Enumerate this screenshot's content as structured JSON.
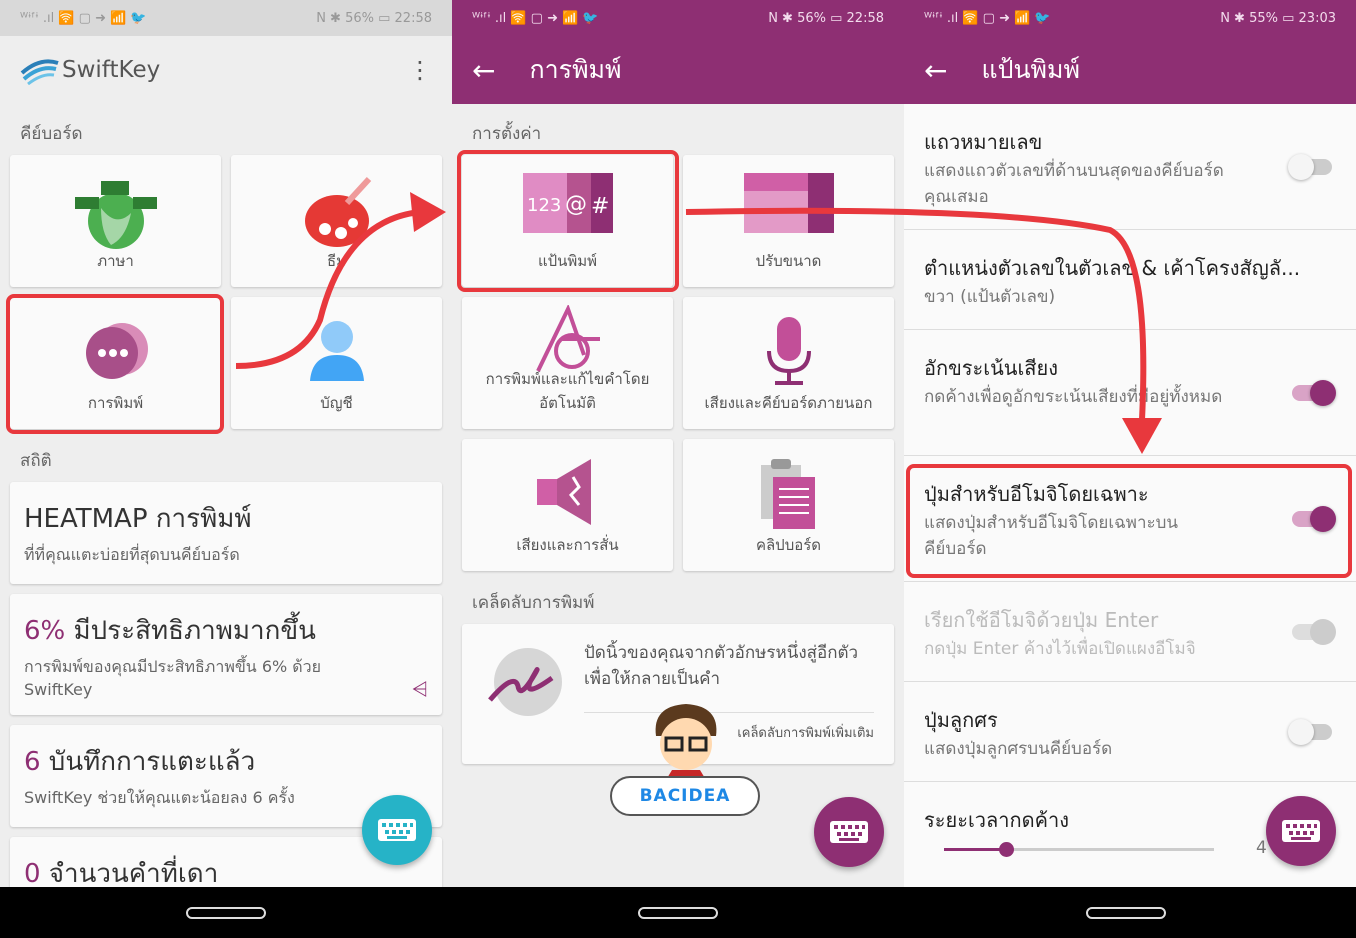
{
  "p1": {
    "status_left": "ᵂᶤᶠᶤ .ıl 🛜 ▢ ➜ 📶 🐦",
    "status_right": "N ✱ 56% ▭ 22:58",
    "app_name": "SwiftKey",
    "section_keyboard": "คีย์บอร์ด",
    "tiles": [
      {
        "label": "ภาษา"
      },
      {
        "label": "ธีม"
      },
      {
        "label": "การพิมพ์"
      },
      {
        "label": "บัญชี"
      }
    ],
    "section_stats": "สถิติ",
    "cards": [
      {
        "title": "HEATMAP การพิมพ์",
        "sub": "ที่ที่คุณแตะบ่อยที่สุดบนคีย์บอร์ด"
      },
      {
        "num": "6%",
        "title": " มีประสิทธิภาพมากขึ้น",
        "sub": "การพิมพ์ของคุณมีประสิทธิภาพขึ้น 6% ด้วย SwiftKey"
      },
      {
        "num": "6",
        "title": " บันทึกการแตะแล้ว",
        "sub": "SwiftKey ช่วยให้คุณแตะน้อยลง 6 ครั้ง"
      },
      {
        "num": "0",
        "title": " จำนวนคำที่เดา"
      }
    ]
  },
  "p2": {
    "status_right": "N ✱ 56% ▭ 22:58",
    "title": "การพิมพ์",
    "section_settings": "การตั้งค่า",
    "tiles": [
      {
        "label": "แป้นพิมพ์"
      },
      {
        "label": "ปรับขนาด"
      },
      {
        "label": "การพิมพ์และแก้ไขคำโดยอัตโนมัติ"
      },
      {
        "label": "เสียงและคีย์บอร์ดภายนอก"
      },
      {
        "label": "เสียงและการสั่น"
      },
      {
        "label": "คลิปบอร์ด"
      }
    ],
    "section_tips": "เคล็ดลับการพิมพ์",
    "tip_text": "ปัดนิ้วของคุณจากตัวอักษรหนึ่งสู่อีกตัวเพื่อให้กลายเป็นคำ",
    "tip_more": "เคล็ดลับการพิมพ์เพิ่มเติม",
    "watermark": "BACIDEA"
  },
  "p3": {
    "status_right": "N ✱ 55% ▭ 23:03",
    "title": "แป้นพิมพ์",
    "settings": [
      {
        "title": "แถวหมายเลข",
        "desc": "แสดงแถวตัวเลขที่ด้านบนสุดของคีย์บอร์ดคุณเสมอ",
        "on": false
      },
      {
        "title": "ตำแหน่งตัวเลขในตัวเลข & เค้าโครงสัญลั...",
        "desc": "ขวา (แป้นตัวเลข)"
      },
      {
        "title": "อักขระเน้นเสียง",
        "desc": "กดค้างเพื่อดูอักขระเน้นเสียงที่มีอยู่ทั้งหมด",
        "on": true
      },
      {
        "title": "ปุ่มสำหรับอีโมจิโดยเฉพาะ",
        "desc": "แสดงปุ่มสำหรับอีโมจิโดยเฉพาะบนคีย์บอร์ด",
        "on": true
      },
      {
        "title": "เรียกใช้อีโมจิด้วยปุ่ม Enter",
        "desc": "กดปุ่ม Enter ค้างไว้เพื่อเปิดแผงอีโมจิ",
        "on": false
      },
      {
        "title": "ปุ่มลูกศร",
        "desc": "แสดงปุ่มลูกศรบนคีย์บอร์ด",
        "on": false
      },
      {
        "title": "ระยะเวลากดค้าง",
        "value": "4"
      }
    ],
    "slider_value": 0.23
  },
  "colors": {
    "accent": "#8e2f73",
    "teal_fab": "#26b3c7",
    "highlight": "#e8383d"
  }
}
